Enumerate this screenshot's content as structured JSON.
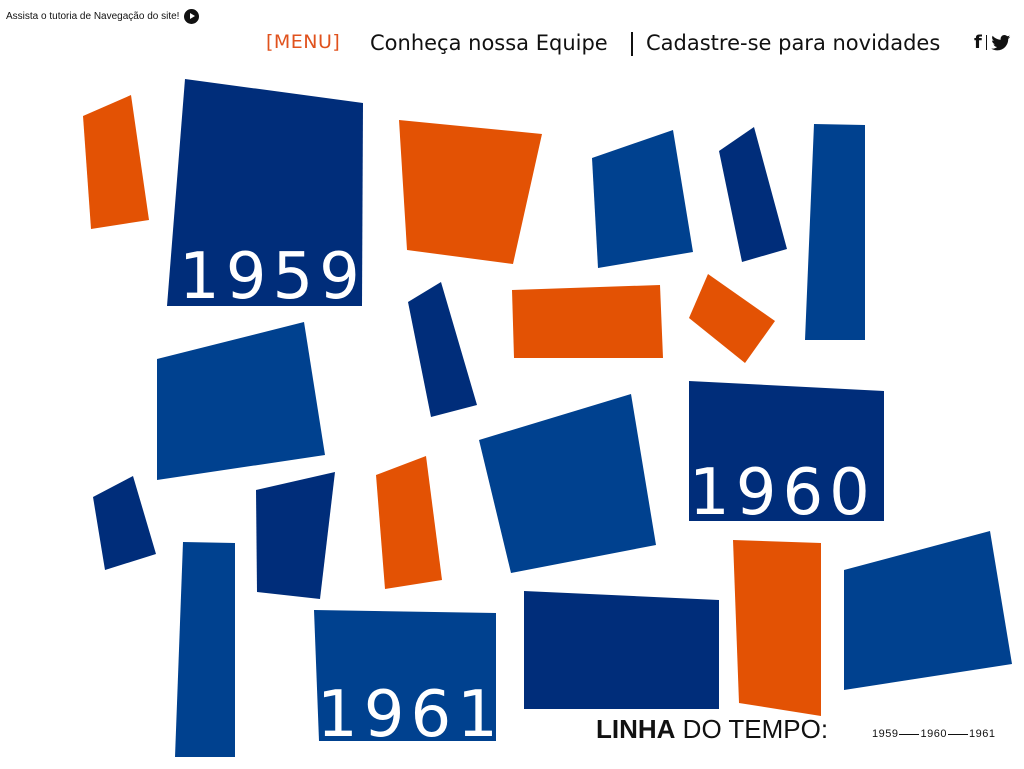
{
  "header": {
    "tutorial_label": "Assista o tutoria de Navegação do site!",
    "menu_label": "[MENU]",
    "nav_team": "Conheça nossa Equipe",
    "nav_signup": "Cadastre-se para novidades",
    "social_facebook": "f",
    "social_twitter": "twitter-icon"
  },
  "timeline": {
    "years": [
      "1959",
      "1960",
      "1961"
    ],
    "title_bold": "LINHA",
    "title_rest": " DO TEMPO:"
  },
  "colors": {
    "navy": "#002d7a",
    "blue": "#00418f",
    "orange": "#e35204",
    "accent": "#e0521d"
  }
}
